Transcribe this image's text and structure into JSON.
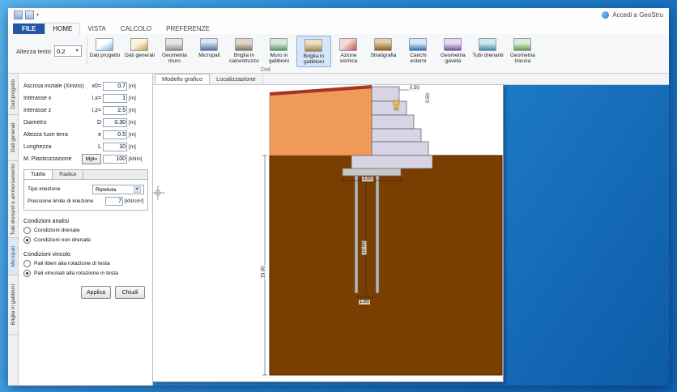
{
  "titlebar": {
    "signin": "Accedi a GeoStru"
  },
  "menu": {
    "tabs": [
      {
        "label": "FILE"
      },
      {
        "label": "HOME"
      },
      {
        "label": "VISTA"
      },
      {
        "label": "CALCOLO"
      },
      {
        "label": "PREFERENZE"
      }
    ]
  },
  "ribbon": {
    "text_height_label": "Altezza testo",
    "text_height_value": "0,2",
    "group_label": "Dati",
    "buttons": [
      {
        "label": "Dati progetto"
      },
      {
        "label": "Dati generali"
      },
      {
        "label": "Geometria muro"
      },
      {
        "label": "Micropali"
      },
      {
        "label": "Briglia in calcestruzzo"
      },
      {
        "label": "Muro in gabbioni"
      },
      {
        "label": "Briglia in gabbioni"
      },
      {
        "label": "Azione sismica"
      },
      {
        "label": "Stratigrafia"
      },
      {
        "label": "Carichi esterni"
      },
      {
        "label": "Geometria gaveta"
      },
      {
        "label": "Tubi drenanti"
      },
      {
        "label": "Geometria traccia"
      }
    ]
  },
  "side_tabs": [
    {
      "label": "Dati progetto"
    },
    {
      "label": "Dati generali"
    },
    {
      "label": "Tubi drenanti e ammorsamento"
    },
    {
      "label": "Micropali"
    },
    {
      "label": "Briglia in gabbioni"
    }
  ],
  "panel": {
    "fields": [
      {
        "label": "Ascissa iniziale (Xinizio)",
        "symbol": "x0=",
        "value": "0.7",
        "unit": "[m]"
      },
      {
        "label": "Interasse x",
        "symbol": "i,x=",
        "value": "1",
        "unit": "[m]"
      },
      {
        "label": "Interasse z",
        "symbol": "i,z=",
        "value": "2.5",
        "unit": "[m]"
      },
      {
        "label": "Diametro",
        "symbol": "D",
        "value": "0.30",
        "unit": "[m]"
      },
      {
        "label": "Altezza fuori terra",
        "symbol": "e",
        "value": "0.5",
        "unit": "[m]"
      },
      {
        "label": "Lunghezza",
        "symbol": "L",
        "value": "10",
        "unit": "[m]"
      }
    ],
    "plastic": {
      "label": "M. Plasticizzazione",
      "button": "Mpl=",
      "value": "100",
      "unit": "[kNm]"
    },
    "pile_tabs": [
      {
        "label": "Tubfix"
      },
      {
        "label": "Radice"
      }
    ],
    "injection_label": "Tipo iniezione",
    "injection_value": "Ripetuta",
    "pressure_label": "Pressione limite di iniezione",
    "pressure_value": "7",
    "pressure_unit": "[kN/cm²]",
    "analysis": {
      "title": "Condizioni analisi",
      "options": [
        {
          "label": "Condizioni drenate"
        },
        {
          "label": "Condizioni non drenate"
        }
      ]
    },
    "constraint": {
      "title": "Condizioni vincolo",
      "options": [
        {
          "label": "Pali liberi alla rotazione di testa"
        },
        {
          "label": "Pali vincolati alla rotazione in testa"
        }
      ]
    },
    "apply_label": "Applica",
    "close_label": "Chiudi"
  },
  "canvas": {
    "tabs": [
      {
        "label": "Modello grafico"
      },
      {
        "label": "Localizzazione"
      }
    ],
    "dims": {
      "height": "15.00",
      "pile_length": "10.00",
      "slab_width": "3.00",
      "pile_spacing": "1.00",
      "top_width": "0.50",
      "step": "0.50"
    }
  }
}
